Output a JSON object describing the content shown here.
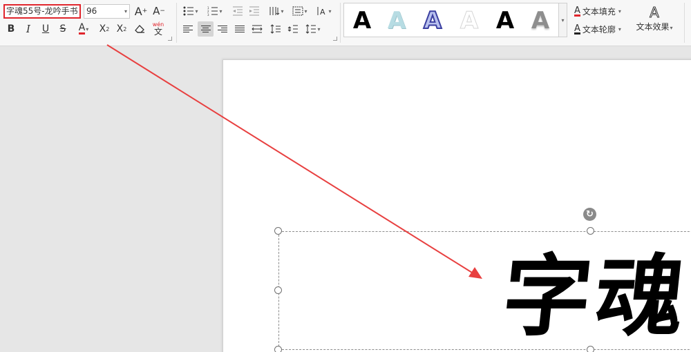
{
  "ribbon": {
    "font_name": "字魂55号-龙吟手书",
    "font_size": "96",
    "grow_font_icon": "A",
    "shrink_font_icon": "A",
    "bold": "B",
    "italic": "I",
    "underline": "U",
    "strikethrough": "S",
    "font_color": "A",
    "superscript": "X",
    "superscript_mark": "2",
    "subscript": "X",
    "subscript_mark": "2",
    "phonetic_top": "wén",
    "phonetic_bottom": "文"
  },
  "text_styles": [
    {
      "glyph": "A",
      "style": "black-fill-white-outline"
    },
    {
      "glyph": "A",
      "style": "light-blue-gradient"
    },
    {
      "glyph": "A",
      "style": "blue-outline"
    },
    {
      "glyph": "A",
      "style": "white-outline"
    },
    {
      "glyph": "A",
      "style": "black-fill"
    },
    {
      "glyph": "A",
      "style": "gray-gradient"
    }
  ],
  "text_tools": {
    "fill_icon": "A",
    "fill_label": "文本填充",
    "outline_icon": "A",
    "outline_label": "文本轮廓",
    "effect_icon": "A",
    "effect_label": "文本效果"
  },
  "canvas": {
    "text": "字魂"
  },
  "colors": {
    "highlight": "#e0242b",
    "arrow": "#e84040",
    "font_color_underline": "#e0242b"
  }
}
